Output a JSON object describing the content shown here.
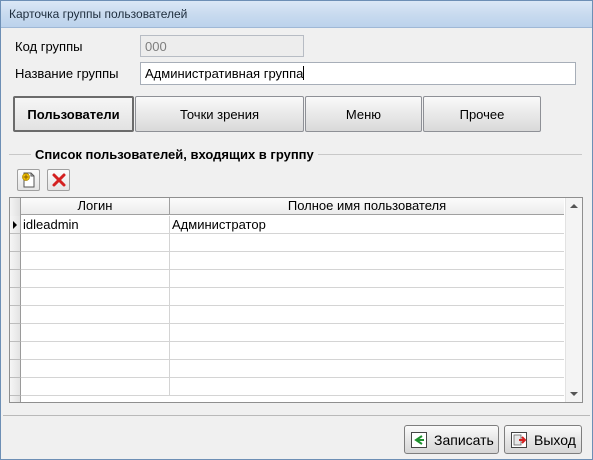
{
  "window": {
    "title": "Карточка группы пользователей"
  },
  "form": {
    "code_label": "Код группы",
    "code_value": "000",
    "name_label": "Название группы",
    "name_value": "Административная группа"
  },
  "tabs": [
    {
      "label": "Пользователи",
      "active": true
    },
    {
      "label": "Точки зрения",
      "active": false
    },
    {
      "label": "Меню",
      "active": false
    },
    {
      "label": "Прочее",
      "active": false
    }
  ],
  "users_group": {
    "title": "Список пользователей, входящих в группу",
    "toolbar": {
      "add_icon": "add-document-icon",
      "delete_icon": "delete-x-icon"
    },
    "columns": [
      "Логин",
      "Полное имя пользователя"
    ],
    "rows": [
      {
        "login": "idleadmin",
        "full_name": "Администратор",
        "current": true
      }
    ]
  },
  "footer": {
    "save_label": "Записать",
    "exit_label": "Выход"
  },
  "colors": {
    "delete": "#d42020",
    "add": "#e8b400",
    "accent_green": "#1e8f2e"
  }
}
